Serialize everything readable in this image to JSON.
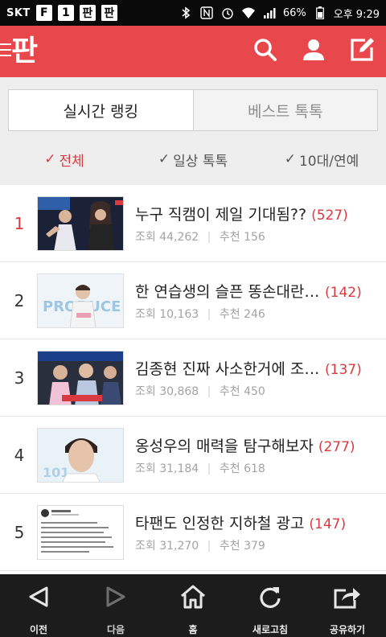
{
  "status_bar": {
    "carrier": "SKT",
    "app_icon_1": "F",
    "app_icon_2": "1",
    "app_icon_3": "판",
    "app_icon_4": "판",
    "battery": "66%",
    "time": "오후 9:29"
  },
  "header": {
    "logo": "판",
    "icons": [
      "search-icon",
      "user-icon",
      "edit-icon"
    ],
    "accent": "#e8474c"
  },
  "tabs": [
    {
      "label": "실시간 랭킹",
      "active": true
    },
    {
      "label": "베스트 톡톡",
      "active": false
    }
  ],
  "filters": [
    {
      "label": "전체",
      "active": true
    },
    {
      "label": "일상 톡톡",
      "active": false
    },
    {
      "label": "10대/연예",
      "active": false
    }
  ],
  "posts": [
    {
      "rank": "1",
      "title": "누구 직캠이 제일 기대됨??",
      "comments": "(527)",
      "views_label": "조회",
      "views": "44,262",
      "likes_label": "추천",
      "likes": "156"
    },
    {
      "rank": "2",
      "title": "한 연습생의 슬픈 똥손대란....",
      "comments": "(142)",
      "views_label": "조회",
      "views": "10,163",
      "likes_label": "추천",
      "likes": "246"
    },
    {
      "rank": "3",
      "title": "김종현 진짜 사소한거에 조카…",
      "comments": "(137)",
      "views_label": "조회",
      "views": "30,868",
      "likes_label": "추천",
      "likes": "450"
    },
    {
      "rank": "4",
      "title": "옹성우의 매력을 탐구해보자",
      "comments": "(277)",
      "views_label": "조회",
      "views": "31,184",
      "likes_label": "추천",
      "likes": "618"
    },
    {
      "rank": "5",
      "title": "타팬도 인정한 지하철 광고",
      "comments": "(147)",
      "views_label": "조회",
      "views": "31,270",
      "likes_label": "추천",
      "likes": "379"
    }
  ],
  "bottom_nav": [
    {
      "label": "이전",
      "icon": "back-icon"
    },
    {
      "label": "다음",
      "icon": "forward-icon"
    },
    {
      "label": "홈",
      "icon": "home-icon"
    },
    {
      "label": "새로고침",
      "icon": "refresh-icon"
    },
    {
      "label": "공유하기",
      "icon": "share-icon"
    }
  ]
}
